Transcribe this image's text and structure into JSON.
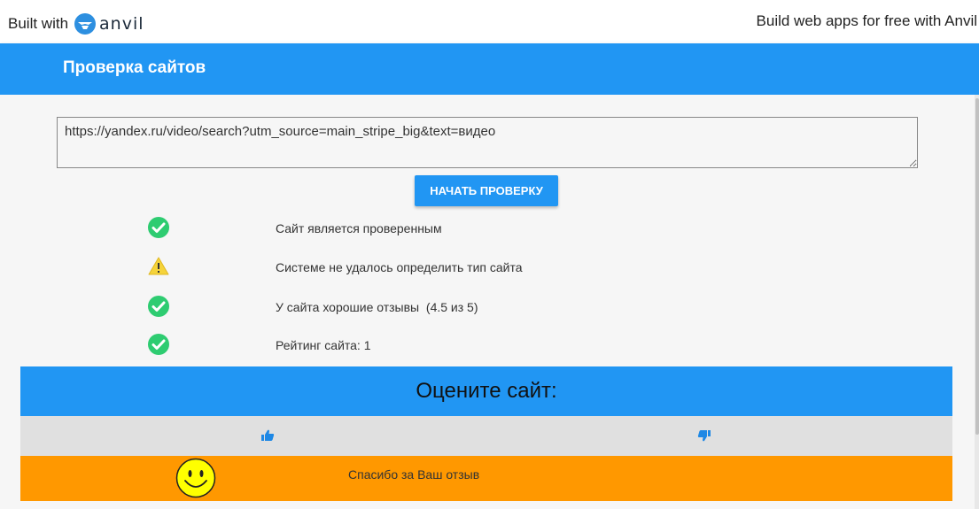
{
  "topbar": {
    "built_with": "Built with",
    "logo_text": "anvil",
    "free_link": "Build web apps for free with Anvil"
  },
  "header": {
    "title": "Проверка сайтов"
  },
  "form": {
    "url_value": "https://yandex.ru/video/search?utm_source=main_stripe_big&text=видео",
    "start_button": "НАЧАТЬ ПРОВЕРКУ"
  },
  "results": [
    {
      "status": "ok",
      "icon": "check-circle-icon",
      "text": "Сайт является проверенным"
    },
    {
      "status": "warning",
      "icon": "warning-icon",
      "text": "Системе не удалось определить тип сайта"
    },
    {
      "status": "ok",
      "icon": "check-circle-icon",
      "text": "У сайта хорошие отзывы  (4.5 из 5)"
    },
    {
      "status": "ok",
      "icon": "check-circle-icon",
      "text": "Рейтинг сайта: 1"
    }
  ],
  "rating": {
    "title": "Оцените сайт:",
    "like_icon": "thumbs-up-icon",
    "dislike_icon": "thumbs-down-icon",
    "thanks_text": "Спасибо за Ваш отзыв",
    "smiley_icon": "smiley-icon"
  },
  "colors": {
    "primary": "#2196f3",
    "success": "#2ecc71",
    "warning": "#f5d33a",
    "feedback": "#ff9800",
    "vote_bar": "#e0e0e0",
    "smiley": "#ffff00"
  }
}
